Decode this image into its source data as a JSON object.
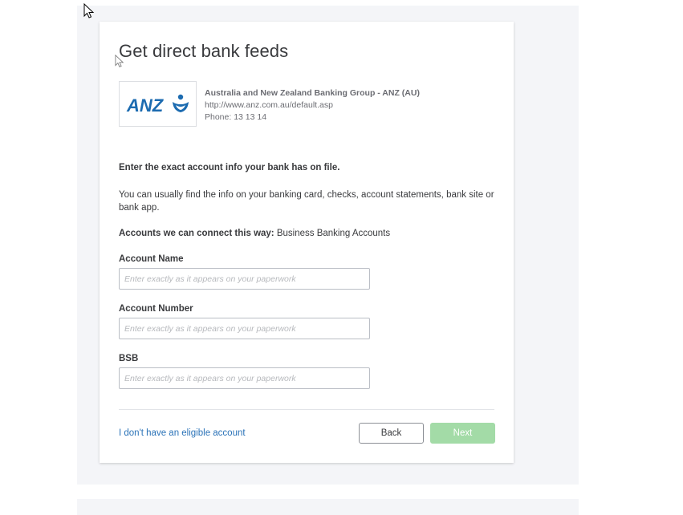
{
  "page": {
    "title": "Get direct bank feeds"
  },
  "bank": {
    "logo_text": "ANZ",
    "logo_color": "#1c6bb0",
    "name": "Australia and New Zealand Banking Group - ANZ (AU)",
    "url": "http://www.anz.com.au/default.asp",
    "phone": "Phone: 13 13 14"
  },
  "instructions": {
    "heading": "Enter the exact account info your bank has on file.",
    "body": "You can usually find the info on your banking card, checks, account statements, bank site or bank app.",
    "accounts_label": "Accounts we can connect this way:",
    "accounts_value": "Business Banking Accounts"
  },
  "form": {
    "account_name": {
      "label": "Account Name",
      "placeholder": "Enter exactly as it appears on your paperwork",
      "value": ""
    },
    "account_number": {
      "label": "Account Number",
      "placeholder": "Enter exactly as it appears on your paperwork",
      "value": ""
    },
    "bsb": {
      "label": "BSB",
      "placeholder": "Enter exactly as it appears on your paperwork",
      "value": ""
    }
  },
  "footer": {
    "no_account_link": "I don't have an eligible account",
    "back_label": "Back",
    "next_label": "Next"
  },
  "colors": {
    "link": "#2b73b8",
    "next_disabled": "#a3dba7",
    "backdrop": "#f4f5f8"
  }
}
